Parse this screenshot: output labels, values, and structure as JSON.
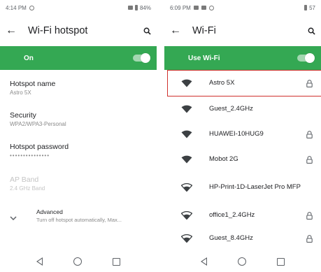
{
  "left_phone": {
    "status": {
      "time": "4:14",
      "ampm": "PM",
      "battery": "84%"
    },
    "appbar": {
      "back_glyph": "←",
      "title": "Wi-Fi hotspot",
      "search_icon": "search-icon"
    },
    "toggle": {
      "label": "On",
      "state": "on"
    },
    "prefs": [
      {
        "title": "Hotspot name",
        "subtitle": "Astro 5X"
      },
      {
        "title": "Security",
        "subtitle": "WPA2/WPA3-Personal"
      },
      {
        "title": "Hotspot password",
        "subtitle": "•••••••••••••••"
      },
      {
        "title": "AP Band",
        "subtitle": "2.4 GHz Band",
        "disabled": true
      }
    ],
    "advanced": {
      "title": "Advanced",
      "subtitle": "Turn off hotspot automatically, Max..."
    }
  },
  "right_phone": {
    "status": {
      "time": "6:09",
      "ampm": "PM",
      "battery": "57"
    },
    "appbar": {
      "back_glyph": "←",
      "title": "Wi-Fi",
      "search_icon": "search-icon"
    },
    "toggle": {
      "label": "Use Wi-Fi",
      "state": "on"
    },
    "networks": [
      {
        "name": "Astro 5X",
        "locked": true,
        "highlighted": true,
        "icon": "wifi-full-icon"
      },
      {
        "name": "Guest_2.4GHz",
        "locked": false,
        "icon": "wifi-full-icon"
      },
      {
        "name": "HUAWEI-10HUG9",
        "locked": true,
        "icon": "wifi-full-icon"
      },
      {
        "name": "Mobot 2G",
        "locked": true,
        "icon": "wifi-full-icon"
      },
      {
        "name": "HP-Print-1D-LaserJet Pro MFP",
        "locked": false,
        "icon": "wifi-outline-icon"
      },
      {
        "name": "office1_2.4GHz",
        "locked": true,
        "icon": "wifi-outline-icon"
      },
      {
        "name": "Guest_8.4GHz",
        "locked": true,
        "icon": "wifi-outline-icon"
      }
    ]
  },
  "colors": {
    "accent": "#34a853",
    "highlight": "#d0312d",
    "text": "#202124",
    "subtext": "#8a8a8a"
  }
}
